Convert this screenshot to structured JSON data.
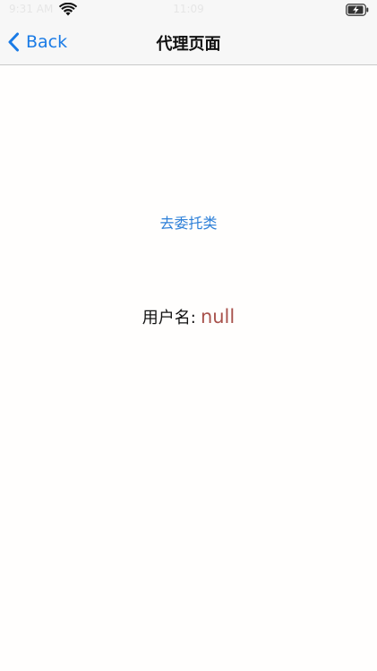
{
  "status_bar": {
    "carrier": "9:31 AM",
    "time": "11:09",
    "wifi_icon": "wifi-icon",
    "battery_icon": "battery-charging-icon"
  },
  "nav": {
    "back_label": "Back",
    "back_icon": "chevron-left-icon",
    "title": "代理页面"
  },
  "main": {
    "delegate_link": "去委托类",
    "username_label": "用户名:",
    "username_value": "null"
  },
  "colors": {
    "accent": "#1a7be6",
    "link": "#2c7fd8",
    "value": "#a8524c"
  }
}
